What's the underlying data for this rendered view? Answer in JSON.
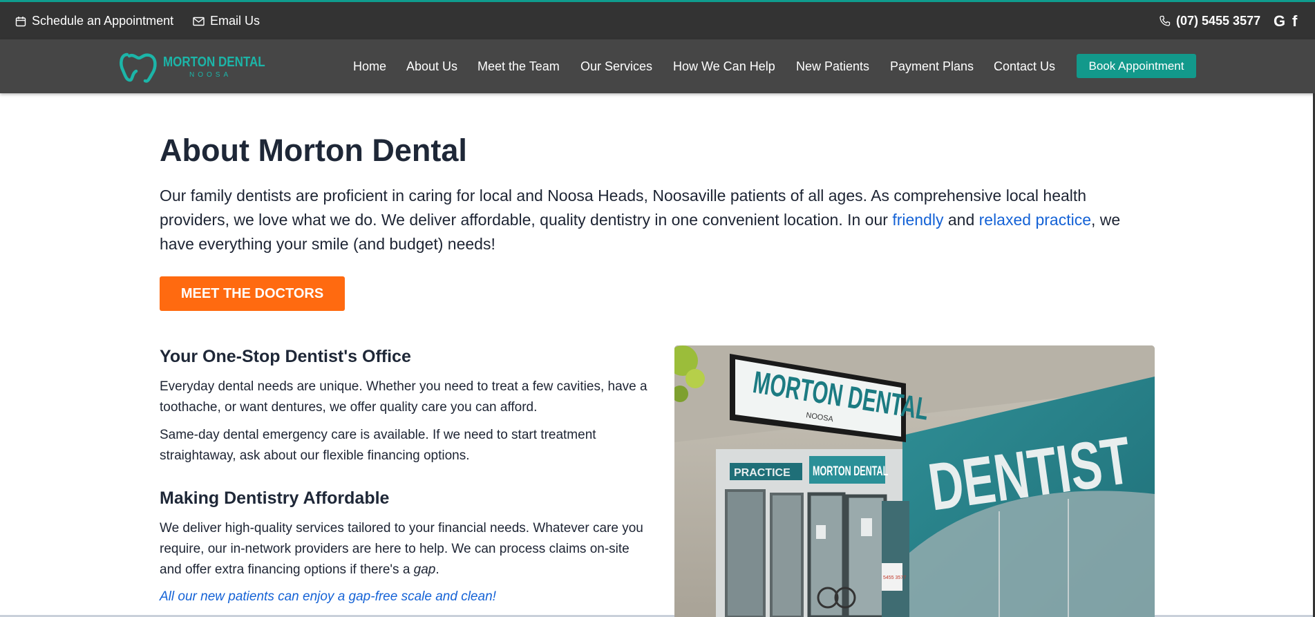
{
  "topbar": {
    "schedule_label": "Schedule an Appointment",
    "email_label": "Email Us",
    "phone": "(07) 5455 3577",
    "google_label": "G",
    "facebook_label": "f",
    "accent": "#0f9d8e"
  },
  "logo": {
    "name": "MORTON DENTAL",
    "sub": "NOOSA",
    "color": "#1cb5a8"
  },
  "nav": {
    "items": [
      "Home",
      "About Us",
      "Meet the Team",
      "Our Services",
      "How We Can Help",
      "New Patients",
      "Payment Plans",
      "Contact Us"
    ],
    "book_label": "Book Appointment",
    "book_color": "#12998b"
  },
  "main": {
    "title": "About Morton Dental",
    "intro": {
      "part1": "Our family dentists are proficient in caring for local and Noosa Heads, Noosaville patients of all ages. As comprehensive local health providers, we love what we do. We deliver affordable, quality dentistry in one convenient location. In our ",
      "link1": "friendly",
      "part2": " and ",
      "link2": "relaxed practice",
      "part3": ", we have everything your smile (and budget) needs!"
    },
    "cta_label": "MEET THE DOCTORS",
    "cta_color": "#ff6a10",
    "section1": {
      "heading": "Your One-Stop Dentist's Office",
      "p1": "Everyday dental needs are unique. Whether you need to treat a few cavities, have a toothache, or want dentures, we offer quality care you can afford.",
      "p2": "Same-day dental emergency care is available. If we need to start treatment straightaway, ask about our flexible financing options."
    },
    "section2": {
      "heading": "Making Dentistry Affordable",
      "p1_main": "We deliver high-quality services tailored to your financial needs. Whatever care you require, our in-network providers are here to help. We can process claims on-site and offer extra financing options if there's a ",
      "p1_em": "gap",
      "p1_end": ".",
      "promo": "All our new patients can enjoy a gap-free scale and clean!"
    },
    "photo": {
      "sign_main": "MORTON DENTAL",
      "sign_sub": "NOOSA",
      "window_text": "DENTIST",
      "small_sign": "MORTON DENTAL",
      "side_sign": "PRACTICE",
      "door_number": "5455 3577"
    }
  }
}
